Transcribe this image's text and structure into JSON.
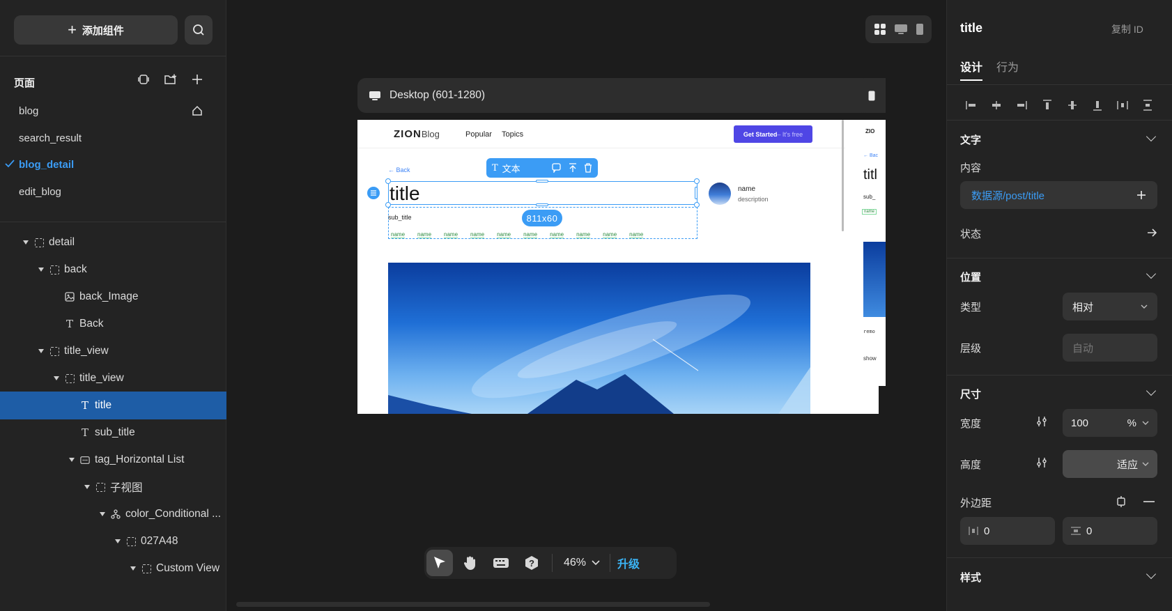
{
  "left": {
    "add_component": "添加组件",
    "pages_title": "页面",
    "pages": [
      {
        "label": "blog"
      },
      {
        "label": "search_result"
      },
      {
        "label": "blog_detail"
      },
      {
        "label": "edit_blog"
      }
    ],
    "tree": [
      {
        "label": "detail"
      },
      {
        "label": "back"
      },
      {
        "label": "back_Image"
      },
      {
        "label": "Back"
      },
      {
        "label": "title_view"
      },
      {
        "label": "title_view"
      },
      {
        "label": "title"
      },
      {
        "label": "sub_title"
      },
      {
        "label": "tag_Horizontal List"
      },
      {
        "label": "子视图"
      },
      {
        "label": "color_Conditional ..."
      },
      {
        "label": "027A48"
      },
      {
        "label": "Custom View"
      }
    ]
  },
  "canvas": {
    "device_label": "Desktop (601-1280)",
    "zoom": "46%",
    "upgrade": "升级",
    "preview": {
      "logo": "ZION",
      "logo_sub": "Blog",
      "nav": [
        "Popular",
        "Topics"
      ],
      "cta_main": "Get Started",
      "cta_sub": " – It's free",
      "back": "← Back",
      "title": "title",
      "sub_title": "sub_title",
      "tag": "name",
      "author_name": "name",
      "author_desc": "description",
      "selection_size": "811x60",
      "toolbar_text": "文本"
    },
    "preview2": {
      "logo": "ZIO",
      "back": "← Bac",
      "title": "titl",
      "sub": "sub_",
      "tag": "name",
      "remote": "remo",
      "show": "show"
    }
  },
  "right": {
    "element_name": "title",
    "copy_id": "复制 ID",
    "tabs": [
      "设计",
      "行为"
    ],
    "text_section": "文字",
    "content_label": "内容",
    "content_value": "数据源/post/title",
    "state_label": "状态",
    "position_section": "位置",
    "type_label": "类型",
    "type_value": "相对",
    "layer_label": "层级",
    "layer_placeholder": "自动",
    "size_section": "尺寸",
    "width_label": "宽度",
    "width_value": "100",
    "width_unit": "%",
    "height_label": "高度",
    "height_value": "适应",
    "margin_label": "外边距",
    "margin_h": "0",
    "margin_v": "0",
    "style_section": "样式"
  },
  "colors": {
    "accent": "#3b9cf5",
    "selection": "#1e5da6",
    "cta": "#4f46e5"
  }
}
